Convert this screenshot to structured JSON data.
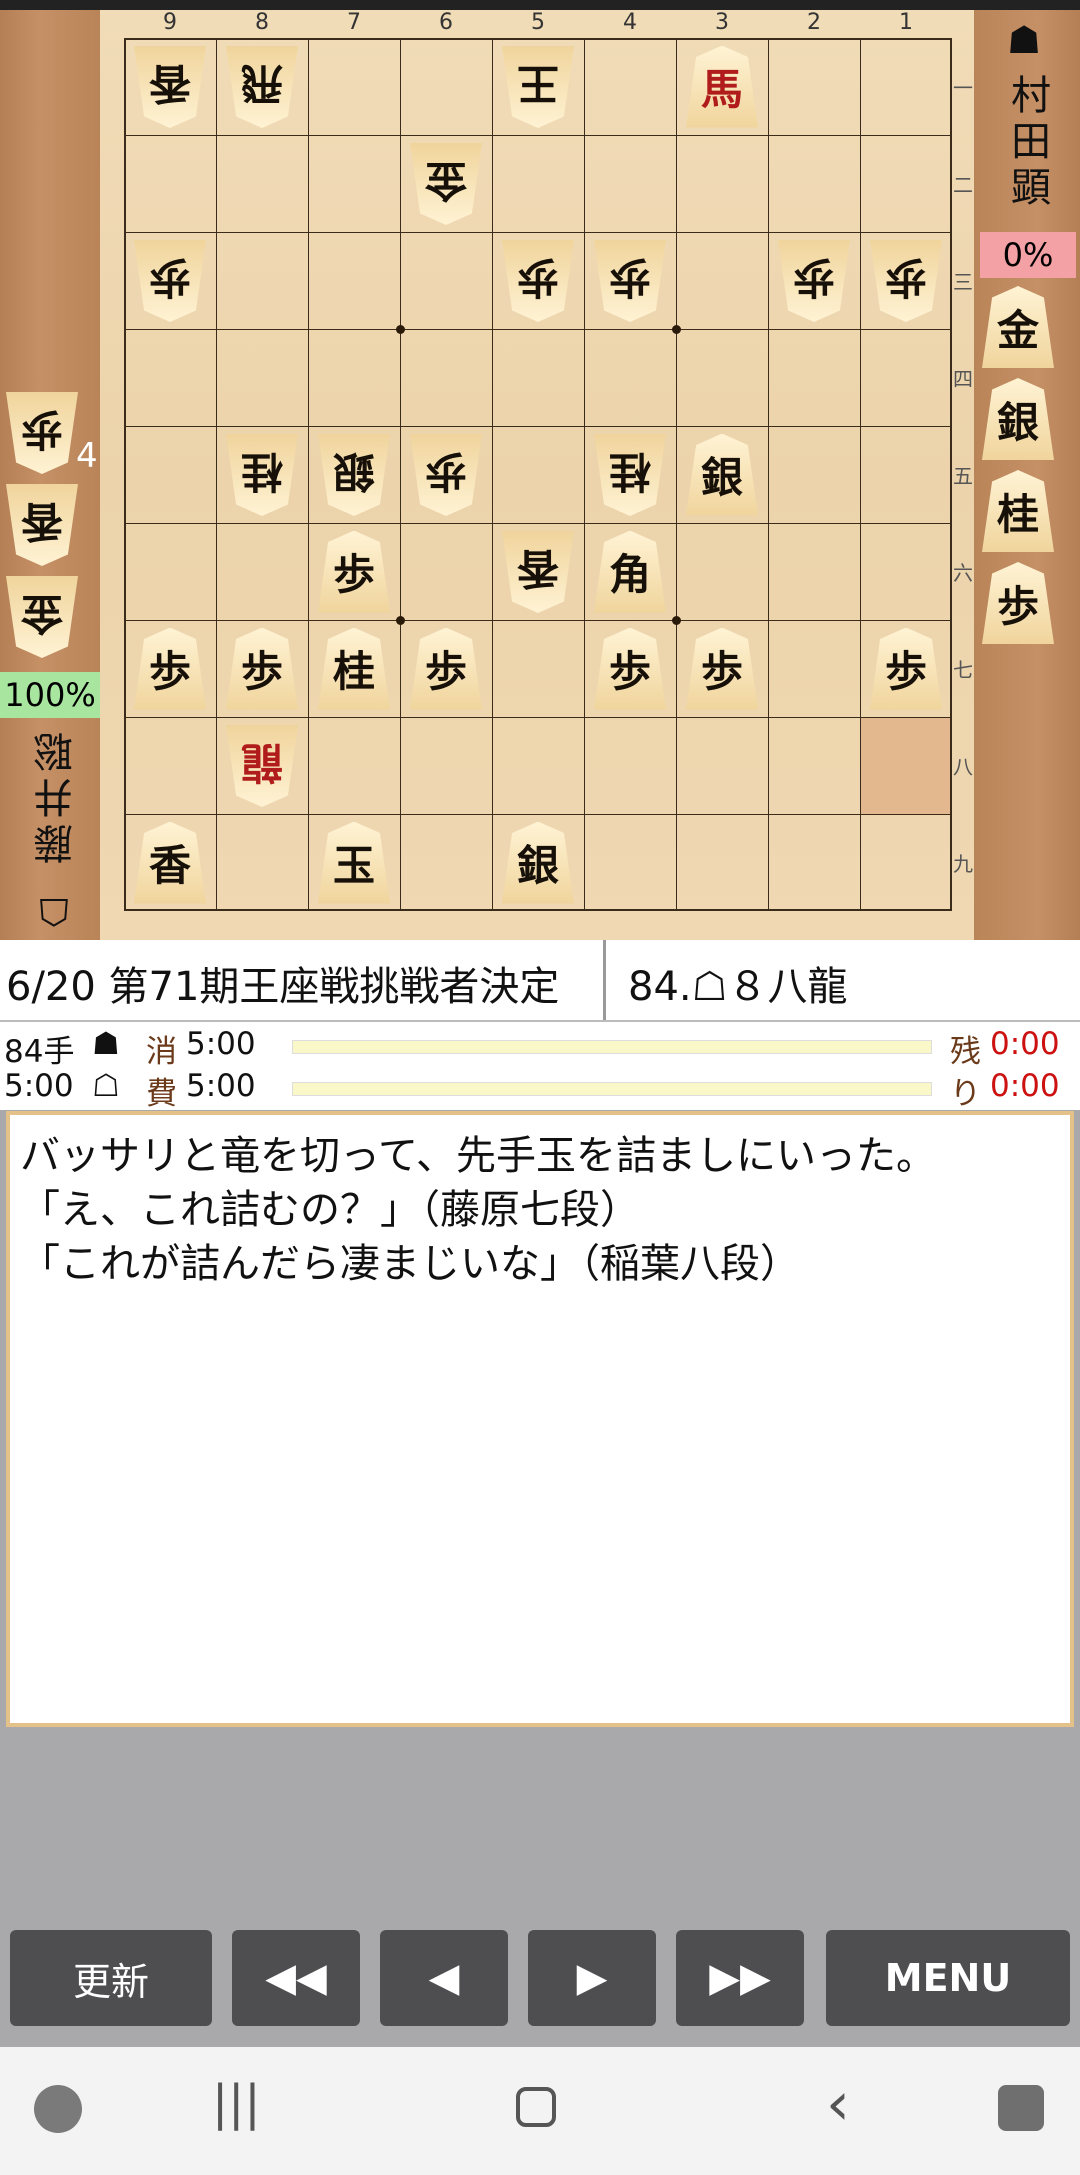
{
  "board": {
    "file_labels": [
      "9",
      "8",
      "7",
      "6",
      "5",
      "4",
      "3",
      "2",
      "1"
    ],
    "rank_labels": [
      "一",
      "二",
      "三",
      "四",
      "五",
      "六",
      "七",
      "八",
      "九"
    ],
    "pieces": [
      {
        "file": 9,
        "rank": 1,
        "glyph": "香",
        "side": "gote"
      },
      {
        "file": 8,
        "rank": 1,
        "glyph": "飛",
        "side": "gote"
      },
      {
        "file": 5,
        "rank": 1,
        "glyph": "王",
        "side": "gote"
      },
      {
        "file": 3,
        "rank": 1,
        "glyph": "馬",
        "side": "sente",
        "promoted": true
      },
      {
        "file": 6,
        "rank": 2,
        "glyph": "金",
        "side": "gote"
      },
      {
        "file": 9,
        "rank": 3,
        "glyph": "歩",
        "side": "gote"
      },
      {
        "file": 5,
        "rank": 3,
        "glyph": "歩",
        "side": "gote"
      },
      {
        "file": 4,
        "rank": 3,
        "glyph": "歩",
        "side": "gote"
      },
      {
        "file": 2,
        "rank": 3,
        "glyph": "歩",
        "side": "gote"
      },
      {
        "file": 1,
        "rank": 3,
        "glyph": "歩",
        "side": "gote"
      },
      {
        "file": 8,
        "rank": 5,
        "glyph": "桂",
        "side": "gote"
      },
      {
        "file": 7,
        "rank": 5,
        "glyph": "銀",
        "side": "gote"
      },
      {
        "file": 6,
        "rank": 5,
        "glyph": "歩",
        "side": "gote"
      },
      {
        "file": 4,
        "rank": 5,
        "glyph": "桂",
        "side": "gote"
      },
      {
        "file": 3,
        "rank": 5,
        "glyph": "銀",
        "side": "sente"
      },
      {
        "file": 7,
        "rank": 6,
        "glyph": "歩",
        "side": "sente"
      },
      {
        "file": 5,
        "rank": 6,
        "glyph": "香",
        "side": "gote"
      },
      {
        "file": 4,
        "rank": 6,
        "glyph": "角",
        "side": "sente"
      },
      {
        "file": 9,
        "rank": 7,
        "glyph": "歩",
        "side": "sente"
      },
      {
        "file": 8,
        "rank": 7,
        "glyph": "歩",
        "side": "sente"
      },
      {
        "file": 7,
        "rank": 7,
        "glyph": "桂",
        "side": "sente"
      },
      {
        "file": 6,
        "rank": 7,
        "glyph": "歩",
        "side": "sente"
      },
      {
        "file": 4,
        "rank": 7,
        "glyph": "歩",
        "side": "sente"
      },
      {
        "file": 3,
        "rank": 7,
        "glyph": "歩",
        "side": "sente"
      },
      {
        "file": 1,
        "rank": 7,
        "glyph": "歩",
        "side": "sente"
      },
      {
        "file": 8,
        "rank": 8,
        "glyph": "龍",
        "side": "gote",
        "promoted": true
      },
      {
        "file": 9,
        "rank": 9,
        "glyph": "香",
        "side": "sente"
      },
      {
        "file": 7,
        "rank": 9,
        "glyph": "玉",
        "side": "sente"
      },
      {
        "file": 5,
        "rank": 9,
        "glyph": "銀",
        "side": "sente"
      }
    ],
    "highlight": {
      "file": 1,
      "rank": 8
    }
  },
  "gote_player": {
    "mark": "☗",
    "name": "村田顕",
    "percent": "0%",
    "hand": [
      "金",
      "銀",
      "桂",
      "歩"
    ]
  },
  "sente_player": {
    "mark": "☖",
    "name": "藤井聡",
    "percent": "100%",
    "hand": [
      "歩",
      "香",
      "金"
    ],
    "pawn_count": "4"
  },
  "info": {
    "title": "6/20  第71期王座戦挑戦者決定",
    "move": "84.☖８八龍"
  },
  "clock": {
    "move_count": "84手",
    "black_mark": "☗",
    "black_used_label": "消",
    "black_used": "5:00",
    "black_remain_label": "残",
    "black_remain": "0:00",
    "white_time": "5:00",
    "white_mark": "☖",
    "white_used_label": "費",
    "white_used": "5:00",
    "white_remain_label": "り",
    "white_remain": "0:00"
  },
  "comment": "バッサリと竜を切って、先手玉を詰ましにいった。\n「え、これ詰むの？」（藤原七段）\n「これが詰んだら凄まじいな」（稲葉八段）",
  "buttons": {
    "refresh": "更新",
    "first": "◀◀",
    "prev": "◀",
    "next": "▶",
    "last": "▶▶",
    "menu": "MENU"
  },
  "navbar": {
    "game_icon": "game-icon",
    "recent_icon": "|||",
    "home_icon": "▢",
    "back_icon": "‹",
    "assist_icon": "assist-icon"
  }
}
